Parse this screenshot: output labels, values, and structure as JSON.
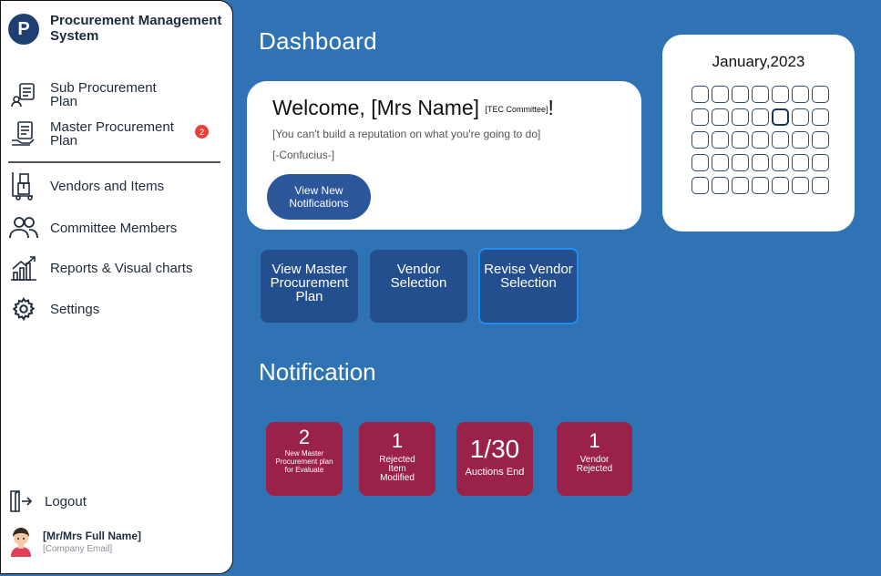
{
  "brand": {
    "logo_letter": "P",
    "title": "Procurement Management System"
  },
  "sidebar": {
    "items": [
      {
        "label": "Sub Procurement Plan",
        "icon": "document-icon"
      },
      {
        "label": "Master Procurement Plan",
        "icon": "contract-icon",
        "badge": "2"
      },
      {
        "label": "Vendors and Items",
        "icon": "delivery-icon"
      },
      {
        "label": "Committee Members",
        "icon": "users-icon"
      },
      {
        "label": "Reports & Visual charts",
        "icon": "chart-icon"
      },
      {
        "label": "Settings",
        "icon": "gear-icon"
      }
    ],
    "logout_label": "Logout",
    "user": {
      "name": "[Mr/Mrs Full Name]",
      "email": "[Company Email]"
    }
  },
  "main": {
    "title": "Dashboard",
    "welcome": {
      "greeting": "Welcome, [Mrs Name]",
      "role": "[TEC Committee]",
      "exclamation": "!",
      "quote": "[You can't build a reputation on what you're going to do]",
      "author": "[-Confucius-]",
      "button_label": "View New Notifications"
    },
    "calendar": {
      "title": "January,2023",
      "selected_row": 1,
      "selected_col": 4
    },
    "actions": [
      {
        "label": "View Master Procurement Plan"
      },
      {
        "label": "Vendor Selection"
      },
      {
        "label": "Revise Vendor Selection"
      }
    ],
    "notification_title": "Notification",
    "stats": [
      {
        "value": "2",
        "label": "New Master Procurement plan for Evaluate"
      },
      {
        "value": "1",
        "label": "Rejected Item Modified"
      },
      {
        "value": "1/30",
        "label": "Auctions End"
      },
      {
        "value": "1",
        "label": "Vendor Rejected"
      }
    ]
  },
  "colors": {
    "background": "#2f73b5",
    "card": "#ffffff",
    "button": "#234f8f",
    "stat": "#9a2248",
    "badge": "#e8413a"
  }
}
